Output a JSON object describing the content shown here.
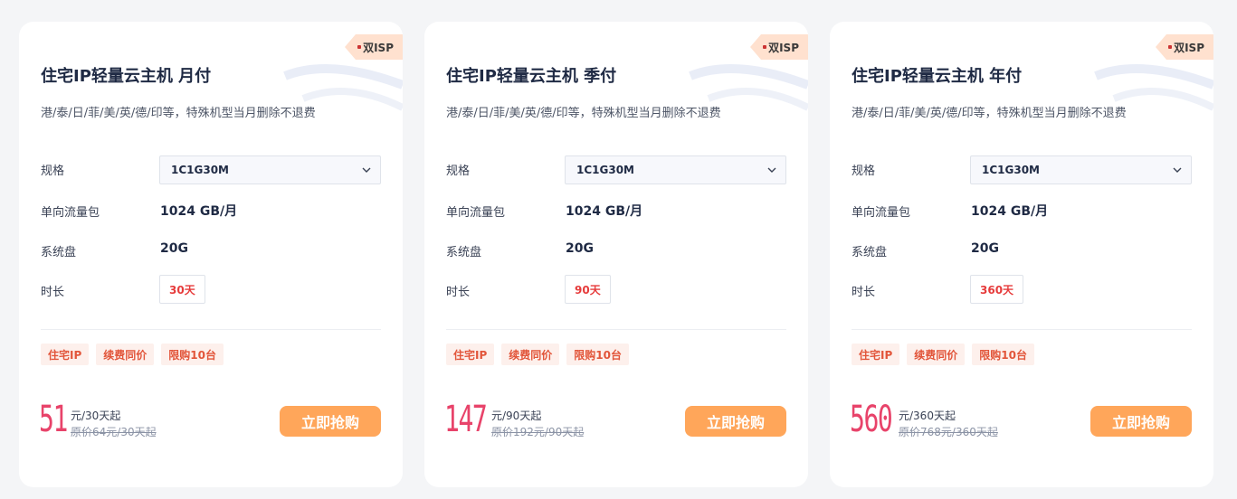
{
  "cards": [
    {
      "ribbon": "双ISP",
      "title": "住宅IP轻量云主机 月付",
      "subtitle": "港/泰/日/菲/美/英/德/印等，特殊机型当月删除不退费",
      "spec_label": "规格",
      "spec_value": "1C1G30M",
      "traffic_label": "单向流量包",
      "traffic_value": "1024 GB/月",
      "disk_label": "系统盘",
      "disk_value": "20G",
      "duration_label": "时长",
      "duration_value": "30天",
      "tags": [
        "住宅IP",
        "续费同价",
        "限购10台"
      ],
      "price": "51",
      "price_unit": "元/30天起",
      "original_price": "原价64元/30天起",
      "buy_label": "立即抢购"
    },
    {
      "ribbon": "双ISP",
      "title": "住宅IP轻量云主机 季付",
      "subtitle": "港/泰/日/菲/美/英/德/印等，特殊机型当月删除不退费",
      "spec_label": "规格",
      "spec_value": "1C1G30M",
      "traffic_label": "单向流量包",
      "traffic_value": "1024 GB/月",
      "disk_label": "系统盘",
      "disk_value": "20G",
      "duration_label": "时长",
      "duration_value": "90天",
      "tags": [
        "住宅IP",
        "续费同价",
        "限购10台"
      ],
      "price": "147",
      "price_unit": "元/90天起",
      "original_price": "原价192元/90天起",
      "buy_label": "立即抢购"
    },
    {
      "ribbon": "双ISP",
      "title": "住宅IP轻量云主机 年付",
      "subtitle": "港/泰/日/菲/美/英/德/印等，特殊机型当月删除不退费",
      "spec_label": "规格",
      "spec_value": "1C1G30M",
      "traffic_label": "单向流量包",
      "traffic_value": "1024 GB/月",
      "disk_label": "系统盘",
      "disk_value": "20G",
      "duration_label": "时长",
      "duration_value": "360天",
      "tags": [
        "住宅IP",
        "续费同价",
        "限购10台"
      ],
      "price": "560",
      "price_unit": "元/360天起",
      "original_price": "原价768元/360天起",
      "buy_label": "立即抢购"
    }
  ],
  "colors": {
    "accent_button": "#ffa65a",
    "price": "#e8436a",
    "tag_text": "#e2553a",
    "ribbon_bg": "#ffe1cf"
  }
}
